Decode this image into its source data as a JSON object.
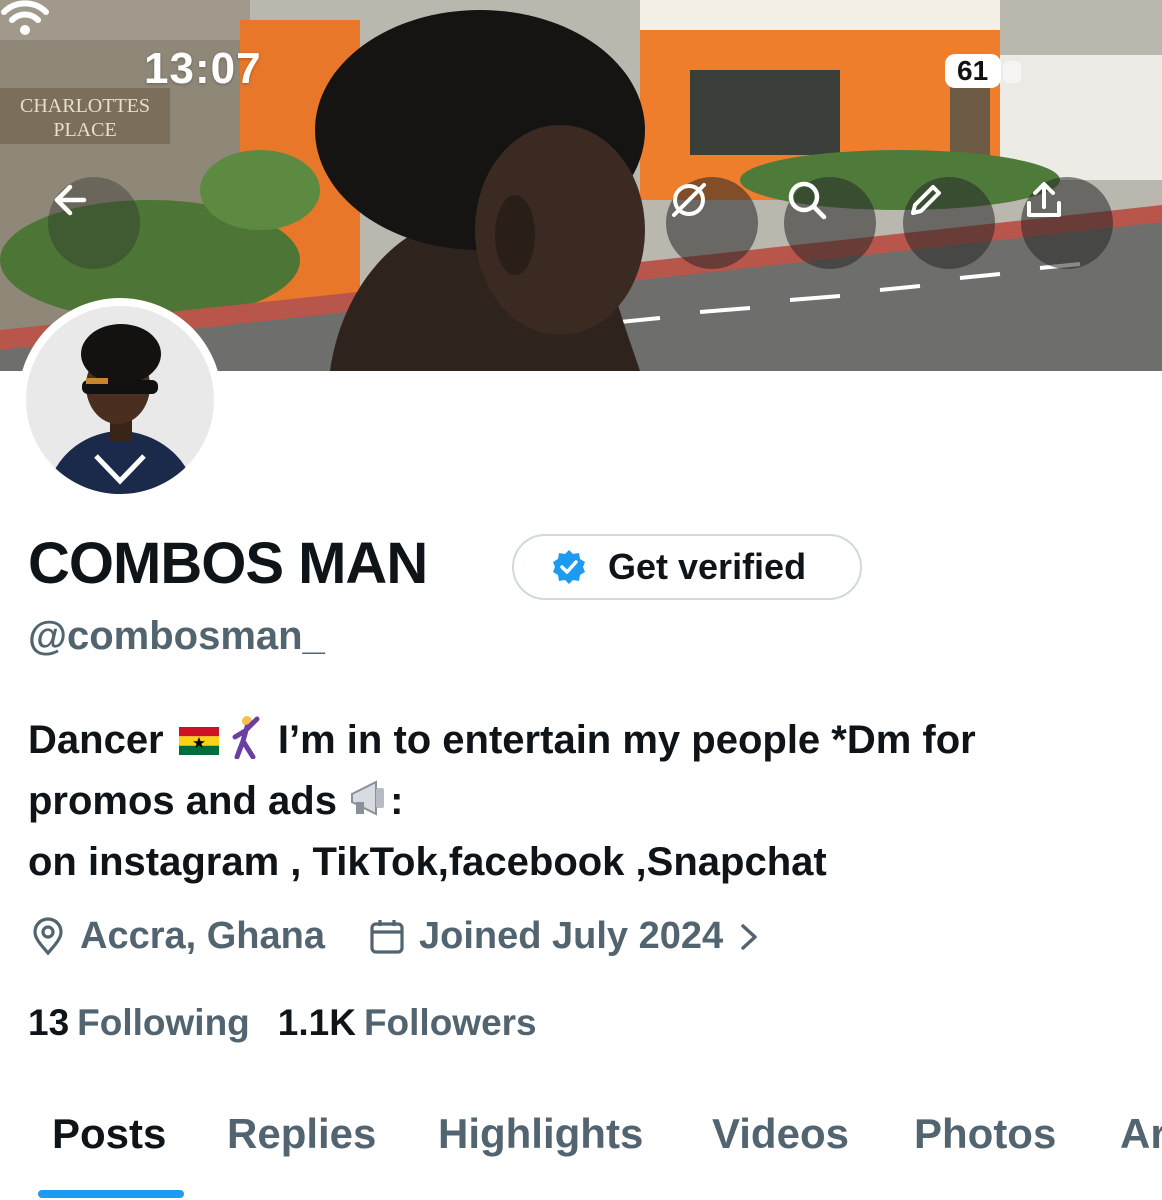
{
  "status_bar": {
    "time": "13:07",
    "battery": "61"
  },
  "banner": {
    "sign_line1": "CHARLOTTES",
    "sign_line2": "PLACE"
  },
  "profile": {
    "display_name": "COMBOS MAN",
    "verify_label": "Get verified",
    "handle": "@combosman_",
    "bio_part1": "Dancer",
    "bio_part2": "I’m in to entertain my people *Dm for",
    "bio_line2": "promos and ads",
    "bio_line2_suffix": ":",
    "bio_line3": "on instagram , TikTok,facebook ,Snapchat",
    "location": "Accra, Ghana",
    "joined": "Joined July 2024",
    "following_count": "13",
    "following_label": "Following",
    "followers_count": "1.1K",
    "followers_label": "Followers"
  },
  "tabs": [
    {
      "label": "Posts",
      "active": true
    },
    {
      "label": "Replies",
      "active": false
    },
    {
      "label": "Highlights",
      "active": false
    },
    {
      "label": "Videos",
      "active": false
    },
    {
      "label": "Photos",
      "active": false
    },
    {
      "label": "Articles",
      "active": false
    }
  ],
  "icons": {
    "back": "arrow-left-icon",
    "grok": "grok-icon",
    "search": "search-icon",
    "edit": "pencil-icon",
    "share": "share-icon",
    "verified": "verified-badge-icon",
    "location": "location-pin-icon",
    "calendar": "calendar-icon"
  },
  "colors": {
    "accent": "#1d9bf0",
    "secondary_text": "#536471",
    "primary_text": "#0f1419"
  }
}
